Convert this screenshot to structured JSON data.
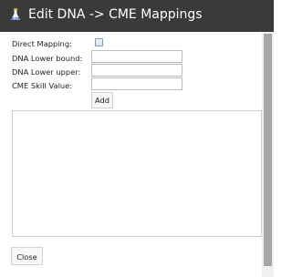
{
  "window": {
    "title": "Edit DNA -> CME Mappings",
    "icon": "flask-icon",
    "titlebar_color": "#3a3a3a"
  },
  "form": {
    "direct_mapping_label": "Direct Mapping:",
    "direct_mapping_checked": false,
    "dna_lower_bound_label": "DNA Lower bound:",
    "dna_lower_bound_value": "",
    "dna_lower_upper_label": "DNA Lower upper:",
    "dna_lower_upper_value": "",
    "cme_skill_value_label": "CME Skill Value:",
    "cme_skill_value_value": "",
    "add_label": "Add"
  },
  "mappings_list": {
    "items": []
  },
  "footer": {
    "close_label": "Close"
  }
}
